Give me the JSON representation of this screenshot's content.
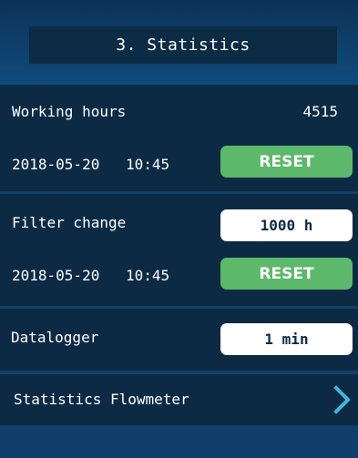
{
  "header": {
    "title": "3. Statistics"
  },
  "working_hours": {
    "label": "Working hours",
    "value": "4515",
    "date": "2018-05-20",
    "time": "10:45",
    "reset_label": "RESET"
  },
  "filter_change": {
    "label": "Filter change",
    "interval": "1000 h",
    "date": "2018-05-20",
    "time": "10:45",
    "reset_label": "RESET"
  },
  "datalogger": {
    "label": "Datalogger",
    "interval": "1 min"
  },
  "flowmeter": {
    "label": "Statistics Flowmeter",
    "icon": "chevron-right-icon"
  },
  "colors": {
    "background": "#0d2a44",
    "accent_green": "#5cb86a",
    "chevron": "#3fb8d8"
  }
}
